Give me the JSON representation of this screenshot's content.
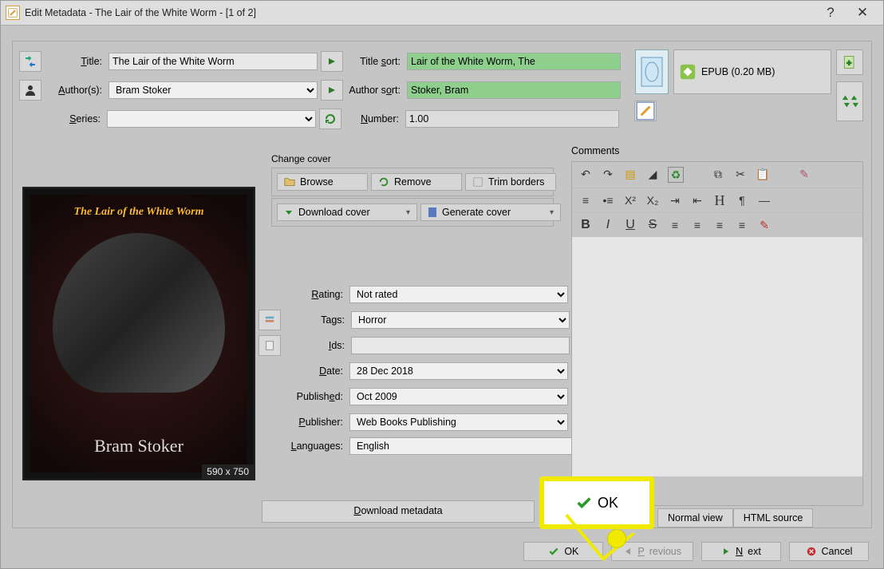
{
  "window": {
    "title": "Edit Metadata - The Lair of the White Worm -  [1 of 2]"
  },
  "labels": {
    "title": "Title:",
    "titlesort": "Title sort:",
    "authors": "Author(s):",
    "authorsort": "Author sort:",
    "series": "Series:",
    "number": "Number:",
    "rating": "Rating:",
    "tags": "Tags:",
    "ids": "Ids:",
    "date": "Date:",
    "published": "Published:",
    "publisher": "Publisher:",
    "languages": "Languages:",
    "comments": "Comments",
    "changecover": "Change cover"
  },
  "values": {
    "title": "The Lair of the White Worm",
    "titlesort": "Lair of the White Worm, The",
    "authors": "Bram Stoker",
    "authorsort": "Stoker, Bram",
    "series": "",
    "number": "1.00",
    "rating": "Not rated",
    "tags": "Horror",
    "ids": "",
    "date": "28 Dec 2018",
    "published": "Oct 2009",
    "publisher": "Web Books Publishing",
    "languages": "English"
  },
  "cover": {
    "title": "The Lair of the White Worm",
    "author": "Bram Stoker",
    "dim": "590 x 750"
  },
  "formats": {
    "item": "EPUB (0.20 MB)"
  },
  "buttons": {
    "browse": "Browse",
    "remove": "Remove",
    "trim": "Trim borders",
    "download": "Download cover",
    "generate": "Generate cover",
    "downloadmeta": "Download metadata",
    "ok": "OK",
    "previous": "Previous",
    "next": "Next",
    "cancel": "Cancel",
    "normalview": "Normal view",
    "htmlsource": "HTML source"
  },
  "highlight": {
    "ok": "OK"
  }
}
